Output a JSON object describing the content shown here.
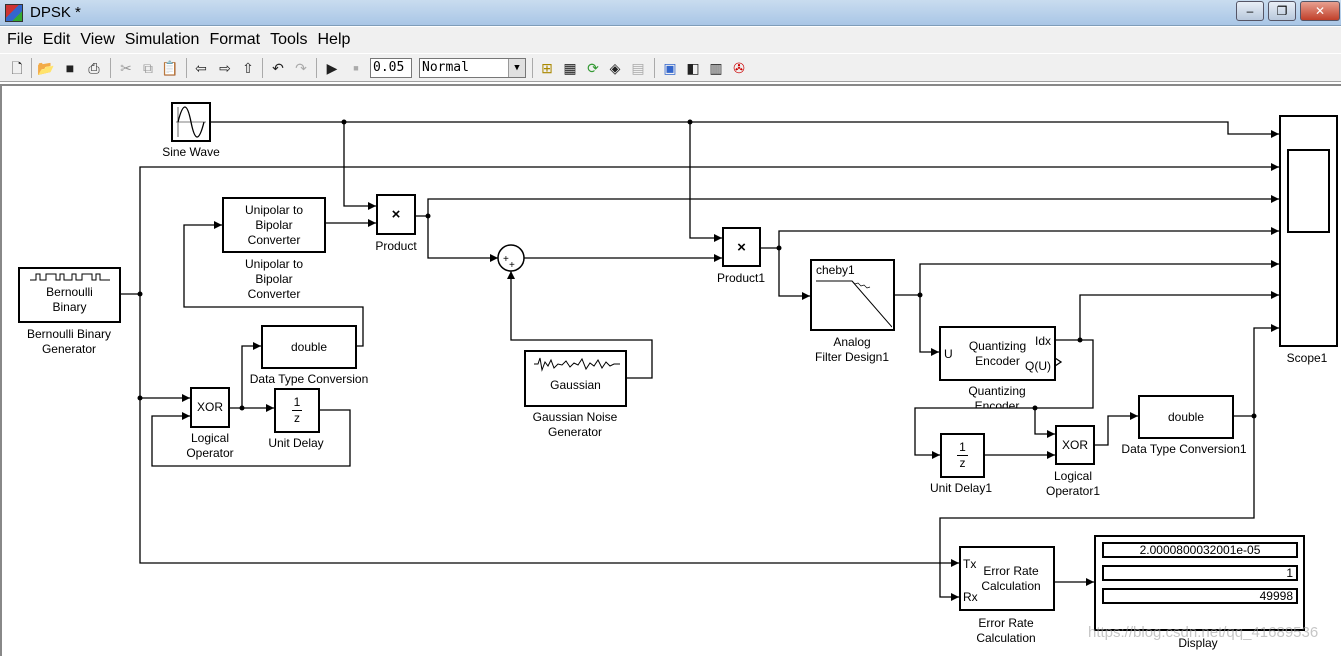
{
  "window": {
    "title": "DPSK *",
    "buttons": [
      "minimize",
      "maximize",
      "close"
    ]
  },
  "menu": [
    "File",
    "Edit",
    "View",
    "Simulation",
    "Format",
    "Tools",
    "Help"
  ],
  "toolbar": {
    "stop_time": "0.05",
    "solver_mode": "Normal",
    "icons": [
      "new-icon",
      "open-icon",
      "save-icon",
      "print-icon",
      "cut-icon",
      "copy-icon",
      "paste-icon",
      "back-icon",
      "forward-icon",
      "up-icon",
      "undo-icon",
      "redo-icon",
      "play-icon",
      "stop-icon",
      "model-explorer-icon",
      "library-icon",
      "update-icon",
      "debug-icon",
      "build-icon",
      "subsystem-icon",
      "browser-icon",
      "properties-icon",
      "debugger-icon"
    ]
  },
  "blocks": {
    "sine": {
      "label": "Sine Wave"
    },
    "bernoulli": {
      "text": "Bernoulli\nBinary",
      "label": "Bernoulli Binary\nGenerator"
    },
    "unipolar": {
      "text": "Unipolar to\nBipolar\nConverter",
      "label": "Unipolar to\nBipolar\nConverter"
    },
    "product": {
      "text": "×",
      "label": "Product"
    },
    "product1": {
      "text": "×",
      "label": "Product1"
    },
    "filter": {
      "text": "cheby1",
      "label": "Analog\nFilter Design1"
    },
    "quantizer": {
      "text": "Quantizing\nEncoder",
      "in": "U",
      "out1": "Idx",
      "out2": "Q(U)",
      "label": "Quantizing\nEncoder"
    },
    "scope": {
      "label": "Scope1"
    },
    "gaussian": {
      "text": "Gaussian",
      "label": "Gaussian Noise\nGenerator"
    },
    "dtc": {
      "text": "double",
      "label": "Data Type Conversion"
    },
    "xor": {
      "text": "XOR",
      "label": "Logical\nOperator"
    },
    "delay": {
      "num": "1",
      "den": "z",
      "label": "Unit Delay"
    },
    "delay1": {
      "num": "1",
      "den": "z",
      "label": "Unit Delay1"
    },
    "xor1": {
      "text": "XOR",
      "label": "Logical\nOperator1"
    },
    "dtc1": {
      "text": "double",
      "label": "Data Type Conversion1"
    },
    "errrate": {
      "text": "Error Rate\nCalculation",
      "tx": "Tx",
      "rx": "Rx",
      "label": "Error Rate\nCalculation"
    },
    "display": {
      "values": [
        "2.0000800032001e-05",
        "1",
        "49998"
      ],
      "label": "Display"
    }
  },
  "watermark": "https://blog.csdn.net/qq_41689536"
}
